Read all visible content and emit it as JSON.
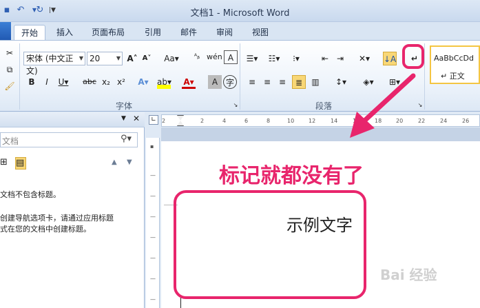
{
  "window": {
    "title": "文档1 - Microsoft Word"
  },
  "tabs": [
    {
      "label": "开始"
    },
    {
      "label": "插入"
    },
    {
      "label": "页面布局"
    },
    {
      "label": "引用"
    },
    {
      "label": "邮件"
    },
    {
      "label": "审阅"
    },
    {
      "label": "视图"
    }
  ],
  "ribbon": {
    "font_name": "宋体 (中文正文)",
    "font_size": "20",
    "group_font": "字体",
    "group_paragraph": "段落",
    "style_preview": "AaBbCcDd",
    "style_name": "↵ 正文"
  },
  "nav": {
    "search_placeholder": "文档",
    "line1": "文档不包含标题。",
    "line2": "创建导航选项卡，请通过应用标题",
    "line3": "式在您的文档中创建标题。"
  },
  "ruler": {
    "marks": [
      "2",
      "2",
      "4",
      "6",
      "8",
      "10",
      "12",
      "14",
      "16",
      "18",
      "20",
      "22",
      "24",
      "26"
    ]
  },
  "annotation": {
    "text": "标记就都没有了",
    "color": "#e8256c"
  },
  "document": {
    "text": "示例文字"
  },
  "watermark": {
    "text": "Bai 经验"
  }
}
